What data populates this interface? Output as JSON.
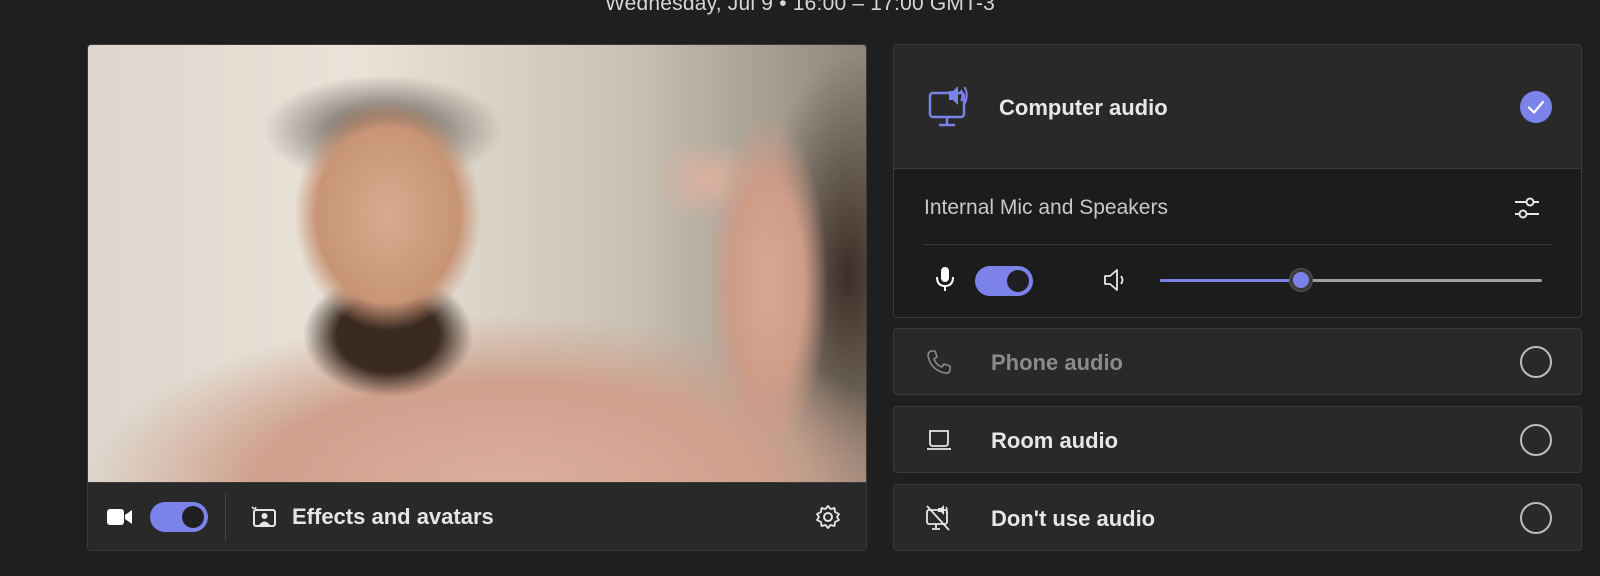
{
  "header": {
    "meeting_time": "Wednesday, Jul 9  •  16:00  –  17:00 GMT-3"
  },
  "video": {
    "camera_toggle_on": true,
    "effects_label": "Effects and avatars",
    "icons": [
      "video-camera-icon",
      "effects-icon",
      "gear-icon"
    ]
  },
  "audio": {
    "computer": {
      "label": "Computer audio",
      "selected": true,
      "device_label": "Internal Mic and Speakers",
      "mic_toggle_on": true,
      "speaker_volume_percent": 37
    },
    "options": [
      {
        "label": "Phone audio",
        "selected": false,
        "enabled": false,
        "icon": "phone-icon"
      },
      {
        "label": "Room audio",
        "selected": false,
        "enabled": true,
        "icon": "room-device-icon"
      },
      {
        "label": "Don't use audio",
        "selected": false,
        "enabled": true,
        "icon": "no-audio-icon"
      }
    ]
  },
  "colors": {
    "accent": "#7b83eb",
    "background": "#1f1f1f",
    "panel": "#292929"
  }
}
